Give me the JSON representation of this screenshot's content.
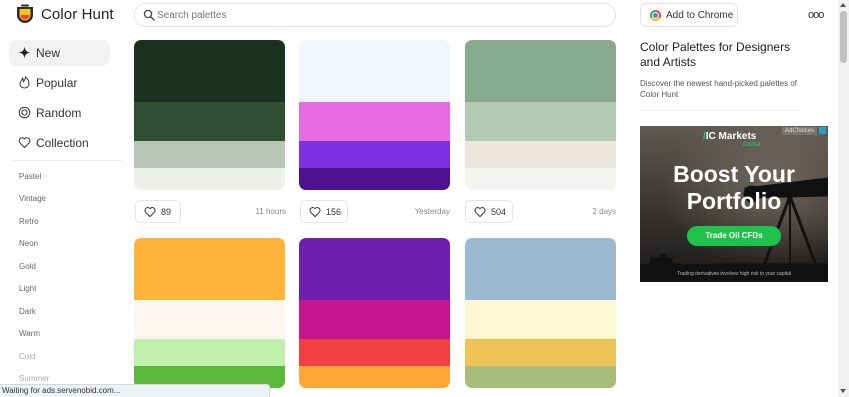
{
  "brand": {
    "name": "Color Hunt"
  },
  "search": {
    "placeholder": "Search palettes"
  },
  "header": {
    "chrome_button": "Add to Chrome",
    "more_label": "ooo"
  },
  "sidebar": {
    "nav": [
      {
        "label": "New",
        "icon": "sparkle-icon",
        "active": true
      },
      {
        "label": "Popular",
        "icon": "flame-icon",
        "active": false
      },
      {
        "label": "Random",
        "icon": "shuffle-icon",
        "active": false
      },
      {
        "label": "Collection",
        "icon": "heart-icon",
        "active": false
      }
    ],
    "tags": [
      "Pastel",
      "Vintage",
      "Retro",
      "Neon",
      "Gold",
      "Light",
      "Dark",
      "Warm",
      "Cold",
      "Summer"
    ]
  },
  "palettes": [
    {
      "colors": [
        "#1b3221",
        "#2e4d31",
        "#b7c6b6",
        "#eef0ea"
      ],
      "likes": "89",
      "time": "11 hours"
    },
    {
      "colors": [
        "#f1f6fe",
        "#e56ae3",
        "#7b2fdf",
        "#4f128f"
      ],
      "likes": "156",
      "time": "Yesterday"
    },
    {
      "colors": [
        "#89ab8d",
        "#b2cab2",
        "#ede6da",
        "#f3f4f0"
      ],
      "likes": "504",
      "time": "2 days"
    },
    {
      "colors": [
        "#ffb338",
        "#fdf5ef",
        "#c2f0ad",
        "#5cb83a"
      ],
      "likes": "",
      "time": ""
    },
    {
      "colors": [
        "#6e1fae",
        "#c5148e",
        "#f04040",
        "#ffa636"
      ],
      "likes": "",
      "time": ""
    },
    {
      "colors": [
        "#9db9cf",
        "#fdf7d3",
        "#eec457",
        "#a9bd7a"
      ],
      "likes": "",
      "time": ""
    }
  ],
  "right_panel": {
    "title": "Color Palettes for Designers and Artists",
    "subtitle": "Discover the newest hand-picked palettes of Color Hunt"
  },
  "ad": {
    "brand": "IC Markets",
    "brand_sub": "Global",
    "adchoices": "AdChoices",
    "headline_1": "Boost Your",
    "headline_2": "Portfolio",
    "cta": "Trade Oil CFDs",
    "disclaimer": "Trading derivatives involves high risk to your capital"
  },
  "status": {
    "text": "Waiting for ads.servenobid.com..."
  },
  "colors": {
    "accent": "#222222",
    "cta_green": "#1fc24a",
    "logo_yellow": "#f5c518"
  }
}
